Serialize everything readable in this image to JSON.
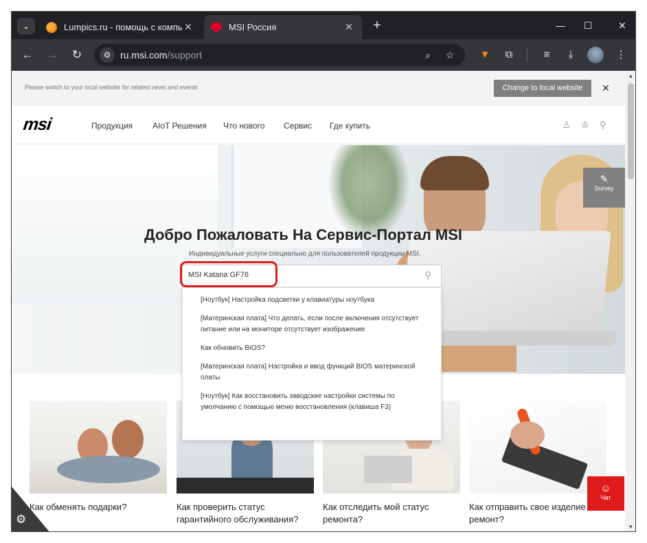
{
  "browser": {
    "tabs": [
      {
        "title": "Lumpics.ru - помощь с компьютером",
        "active": false,
        "favicon": "lumpics-favicon"
      },
      {
        "title": "MSI Россия",
        "active": true,
        "favicon": "msi-favicon"
      }
    ],
    "url_domain": "ru.msi.com",
    "url_path": "/support"
  },
  "banner": {
    "text": "Please switch to your local website for related news and events",
    "button": "Change to local website"
  },
  "header": {
    "logo": "msi",
    "nav": [
      "Продукция",
      "AIoT Решения",
      "Что нового",
      "Сервис",
      "Где купить"
    ]
  },
  "hero": {
    "title": "Добро Пожаловать На Сервис-Портал MSI",
    "subtitle": "Индивидуальные услуги специально для пользователей продукции MSI.",
    "search_value": "MSI Katana GF76",
    "survey_label": "Survey"
  },
  "suggestions": [
    "[Ноутбук] Настройка подсветки у клавиатуры ноутбука",
    "[Материнская плата] Что делать, если после включения отсутствует питание или на мониторе отсутствует изображение",
    "Как обновить BIOS?",
    "[Материнская плата] Настройка и ввод функций BIOS материнской платы",
    "[Ноутбук] Как восстановить заводские настройки системы по умолчанию с помощью меню восстановления (клавиша F3)"
  ],
  "cards": [
    {
      "title": "Как обменять подарки?"
    },
    {
      "title": "Как проверить статус гарантийного обслуживания?"
    },
    {
      "title": "Как отследить мой статус ремонта?"
    },
    {
      "title": "Как отправить свое изделие в ремонт?"
    }
  ],
  "chat_label": "Чат",
  "colors": {
    "accent_red": "#e01b1b",
    "browser_dark": "#202124",
    "toolbar": "#35363a"
  }
}
